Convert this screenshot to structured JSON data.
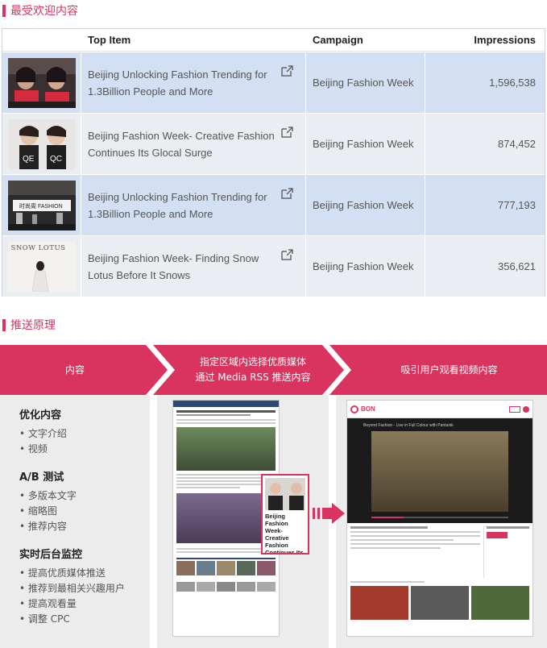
{
  "section1_title": "最受欢迎内容",
  "table": {
    "headers": {
      "top_item": "Top Item",
      "campaign": "Campaign",
      "impressions": "Impressions"
    },
    "rows": [
      {
        "title": "Beijing Unlocking Fashion Trending for 1.3Billion People and More",
        "campaign": "Beijing Fashion Week",
        "impressions": "1,596,538"
      },
      {
        "title": "Beijing Fashion Week- Creative Fashion Continues Its Glocal Surge",
        "campaign": "Beijing Fashion Week",
        "impressions": "874,452"
      },
      {
        "title": "Beijing Unlocking Fashion Trending for 1.3Billion People and More",
        "campaign": "Beijing Fashion Week",
        "impressions": "777,193"
      },
      {
        "title": "Beijing Fashion Week- Finding Snow Lotus Before It Snows",
        "campaign": "Beijing Fashion Week",
        "impressions": "356,621"
      }
    ],
    "thumb4_text": "SNOW LOTUS"
  },
  "section2_title": "推送原理",
  "flow": {
    "step1": "内容",
    "step2_line1": "指定区域内选择优质媒体",
    "step2_line2": "通过 Media RSS 推送内容",
    "step3": "吸引用户观看视频内容",
    "groups": [
      {
        "heading": "优化内容",
        "items": [
          "• 文字介绍",
          "• 视频"
        ]
      },
      {
        "heading": "A/B 测试",
        "items": [
          "• 多版本文字",
          "• 缩略图",
          "• 推荐内容"
        ]
      },
      {
        "heading": "实时后台监控",
        "items": [
          "• 提高优质媒体推送",
          "• 推荐到最相关兴趣用户",
          "• 提高观看量",
          "• 调整 CPC"
        ]
      }
    ],
    "mock_article_highlight": "Beijing Fashion Week- Creative Fashion Continues Its Glocal Surge",
    "mock_video_caption": "Beyond Fashion - Live in Full Colour with Pantanik",
    "mock_brand": "BON"
  },
  "colors": {
    "accent": "#d8345f",
    "row_blue": "#d3e0f4",
    "row_gray": "#eaedf2"
  }
}
